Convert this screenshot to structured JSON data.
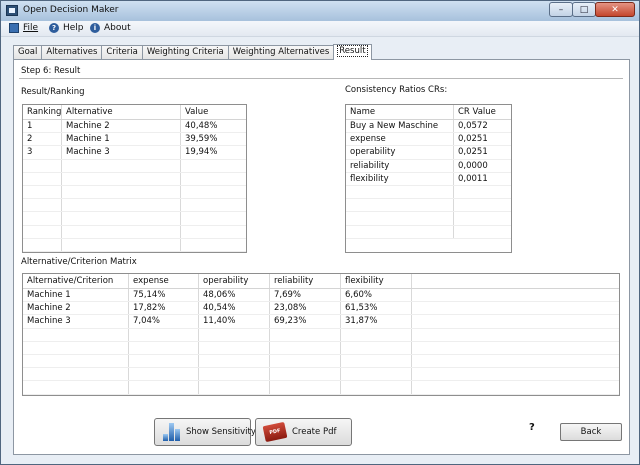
{
  "window": {
    "title": "Open Decision Maker",
    "controls": [
      "–",
      "□",
      "✕"
    ]
  },
  "menu": {
    "items": [
      {
        "label": "File",
        "icon": "file-icon"
      },
      {
        "label": "Help",
        "icon": "help-icon"
      },
      {
        "label": "About",
        "icon": "info-icon"
      }
    ]
  },
  "tabs": [
    "Goal",
    "Alternatives",
    "Criteria",
    "Weighting Criteria",
    "Weighting Alternatives",
    "Result"
  ],
  "active_tab": "Result",
  "step_label": "Step 6: Result",
  "ranking": {
    "label": "Result/Ranking",
    "headers": [
      "Ranking",
      "Alternative",
      "Value"
    ],
    "rows": [
      [
        "1",
        "Machine 2",
        "40,48%"
      ],
      [
        "2",
        "Machine 1",
        "39,59%"
      ],
      [
        "3",
        "Machine 3",
        "19,94%"
      ]
    ]
  },
  "consistency": {
    "label": "Consistency Ratios CRs:",
    "headers": [
      "Name",
      "CR Value"
    ],
    "rows": [
      [
        "Buy a New Maschine",
        "0,0572"
      ],
      [
        "expense",
        "0,0251"
      ],
      [
        "operability",
        "0,0251"
      ],
      [
        "reliability",
        "0,0000"
      ],
      [
        "flexibility",
        "0,0011"
      ]
    ]
  },
  "matrix": {
    "label": "Alternative/Criterion Matrix",
    "headers": [
      "Alternative/Criterion",
      "expense",
      "operability",
      "reliability",
      "flexibility"
    ],
    "rows": [
      [
        "Machine 1",
        "75,14%",
        "48,06%",
        "7,69%",
        "6,60%"
      ],
      [
        "Machine 2",
        "17,82%",
        "40,54%",
        "23,08%",
        "61,53%"
      ],
      [
        "Machine 3",
        "7,04%",
        "11,40%",
        "69,23%",
        "31,87%"
      ]
    ]
  },
  "buttons": {
    "show_sensitivity": "Show Sensitivity",
    "create_pdf": "Create Pdf",
    "help": "?",
    "back": "Back"
  }
}
